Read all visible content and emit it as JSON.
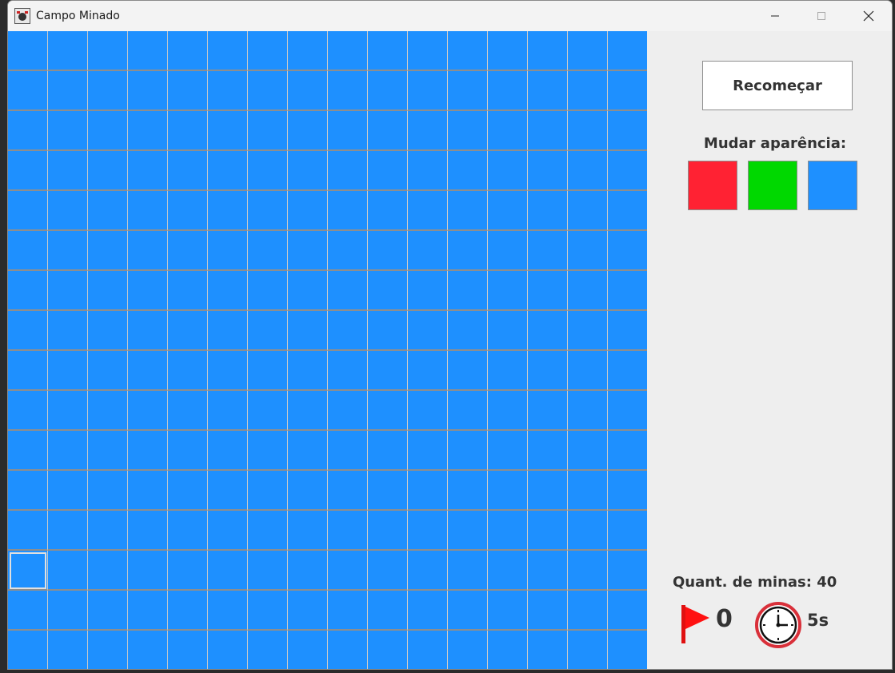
{
  "window": {
    "title": "Campo Minado",
    "minimize_icon": "minimize-icon",
    "maximize_icon": "maximize-icon",
    "close_icon": "close-icon"
  },
  "board": {
    "rows": 16,
    "cols": 16,
    "cell_color": "#1e90ff",
    "focused_cell": {
      "row": 13,
      "col": 0
    }
  },
  "sidebar": {
    "restart_label": "Recomeçar",
    "appearance_label": "Mudar aparência:",
    "themes": [
      {
        "name": "red",
        "color": "#ff2233"
      },
      {
        "name": "green",
        "color": "#00d800"
      },
      {
        "name": "blue",
        "color": "#1e90ff"
      }
    ],
    "mines_label": "Quant. de minas: 40",
    "flags_count": "0",
    "timer_text": "5s"
  }
}
